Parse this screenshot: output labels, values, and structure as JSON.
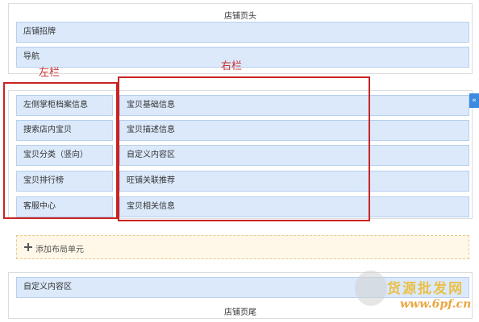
{
  "header": {
    "title": "店铺页头"
  },
  "top_blocks": [
    {
      "label": "店铺招牌"
    },
    {
      "label": "导航"
    }
  ],
  "annotations": {
    "left": "左栏",
    "right": "右栏"
  },
  "left_column": [
    {
      "label": "左侧掌柜档案信息"
    },
    {
      "label": "搜索店内宝贝"
    },
    {
      "label": "宝贝分类（竖向）"
    },
    {
      "label": "宝贝排行榜"
    },
    {
      "label": "客服中心"
    }
  ],
  "right_column": [
    {
      "label": "宝贝基础信息"
    },
    {
      "label": "宝贝描述信息"
    },
    {
      "label": "自定义内容区"
    },
    {
      "label": "旺铺关联推荐"
    },
    {
      "label": "宝贝相关信息"
    }
  ],
  "add_layout": {
    "label": "添加布局单元"
  },
  "bottom": {
    "custom_block": "自定义内容区",
    "footer_title": "店铺页尾"
  },
  "side_tab": {
    "icon": "collapse-arrow-icon",
    "glyph": "«"
  },
  "watermark": {
    "text": "货源批发网",
    "url": "www.6pf.cn"
  },
  "colors": {
    "block_bg": "#dbe9fb",
    "block_border": "#b7cfee",
    "annotation_red": "#c82424",
    "add_bg": "#fff8e8"
  }
}
